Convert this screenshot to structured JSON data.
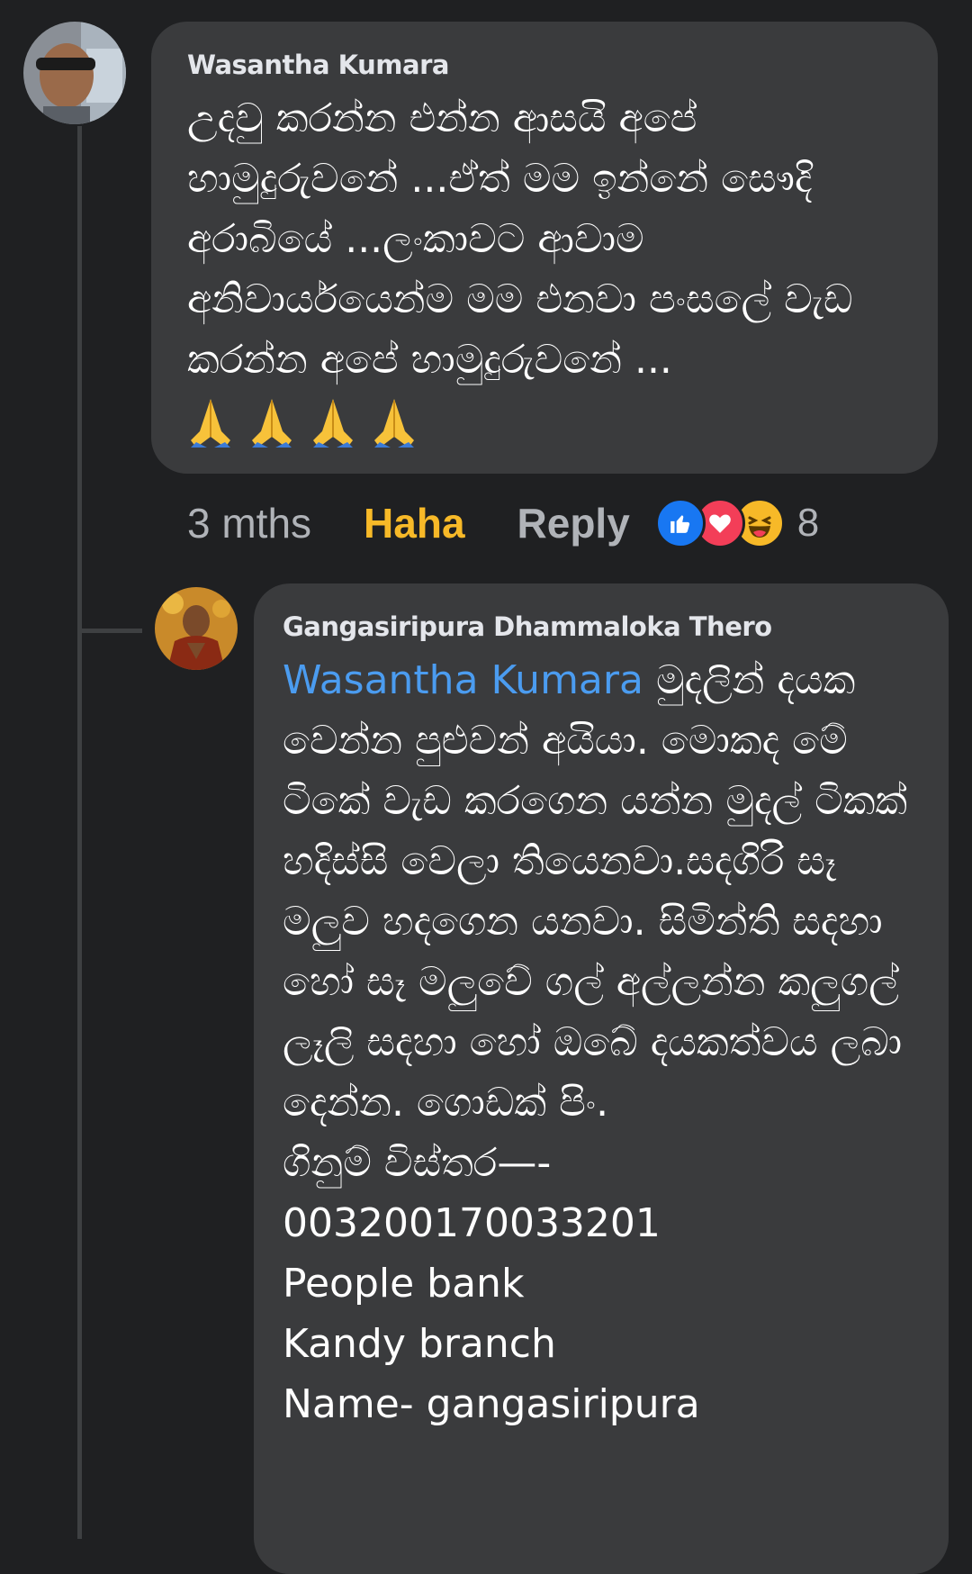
{
  "colors": {
    "background": "#1f2022",
    "bubble": "#3a3b3d",
    "mention": "#4b9cf0",
    "haha_active": "#f7b928",
    "secondary_text": "#b0b3b8"
  },
  "comment": {
    "author": "Wasantha Kumara",
    "text": "උදවු කරන්න එන්න ආසයි අපේ හාමුදුරුවනේ ...ඒත් මම ඉන්නේ සෞදි අරාබියේ ...ලංකාවට ආවාම අනිවාර්යයෙන්ම මම එනවා පංසලේ වැඩ කරන්න අපේ හාමුදුරුවනේ ...",
    "emojis": [
      "folded-hands-emoji",
      "folded-hands-emoji",
      "folded-hands-emoji",
      "folded-hands-emoji"
    ],
    "time": "3 mths",
    "reaction_label": "Haha",
    "reply_label": "Reply",
    "reaction_types": [
      "like-icon",
      "love-icon",
      "haha-icon"
    ],
    "reaction_count": "8"
  },
  "reply": {
    "author": "Gangasiripura Dhammaloka Thero",
    "mention": "Wasantha Kumara",
    "text": " මුදලින් දයක වෙන්න පුළුවන් අයියා. මොකද මේ ටිකේ වැඩ කරගෙන යන්න මුදල් ටිකක් හදිස්සි වෙලා තියෙනවා.සදගිරි සෑ මලුව හදගෙන යනවා. සිමින්ති සදහා හෝ සෑ මලුවේ ගල් අල්ලන්න කලුගල් ලෑලි සදහා හෝ ඔබේ දයකත්වය ලබා දෙන්න. ගොඩක් පිං.\nගිනුම් විස්තර—-\n003200170033201\nPeople bank\nKandy branch\nName- gangasiripura"
  }
}
